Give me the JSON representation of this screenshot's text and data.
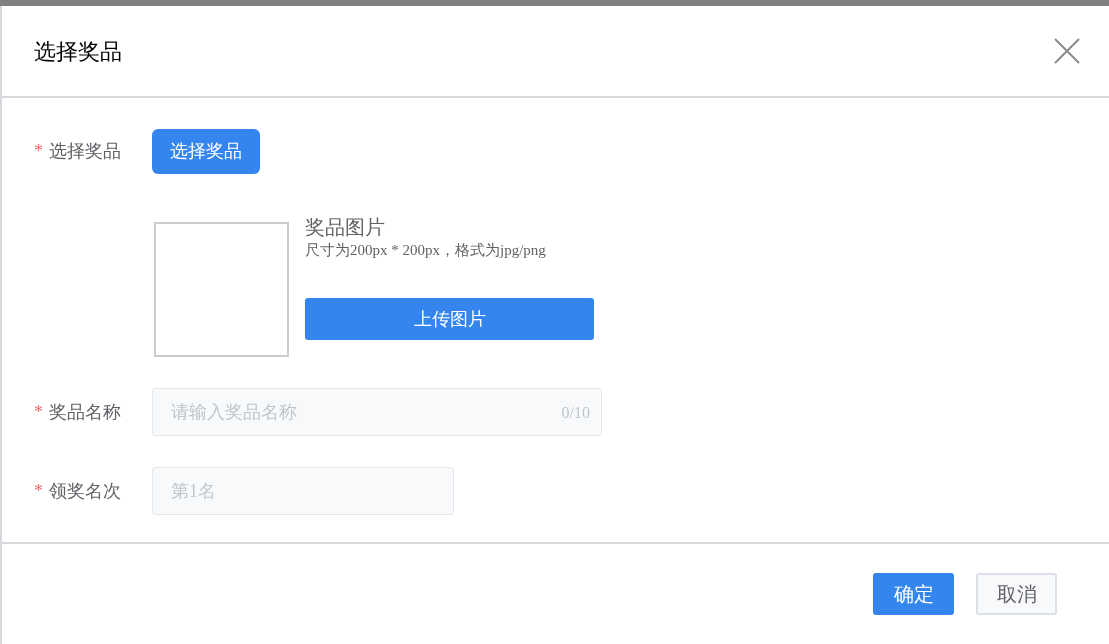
{
  "dialog": {
    "title": "选择奖品"
  },
  "form": [
    {
      "kind": "button",
      "label": "选择奖品",
      "required_mark": "*",
      "button": "选择奖品"
    },
    {
      "kind": "upload",
      "title": "奖品图片",
      "hint": "尺寸为200px * 200px，格式为jpg/png",
      "button": "上传图片"
    },
    {
      "kind": "input",
      "label": "奖品名称",
      "required_mark": "*",
      "placeholder": "请输入奖品名称",
      "counter": "0/10"
    },
    {
      "kind": "input",
      "label": "领奖名次",
      "required_mark": "*",
      "placeholder": "第1名"
    }
  ],
  "footer": {
    "buttons": [
      {
        "label": "确定",
        "kind": "primary"
      },
      {
        "label": "取消",
        "kind": "default"
      }
    ]
  }
}
